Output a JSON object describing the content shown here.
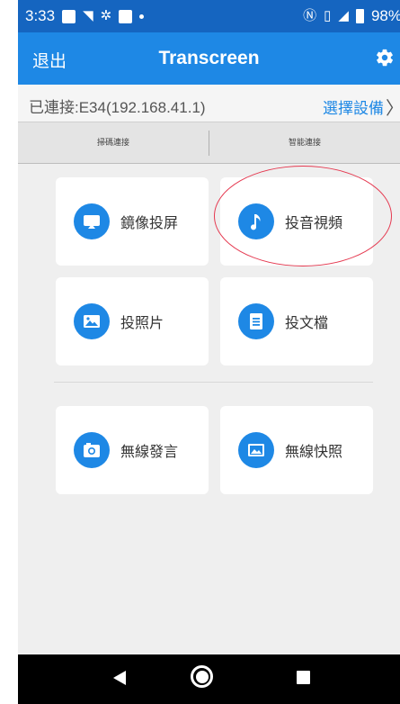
{
  "status_bar": {
    "time": "3:33",
    "battery": "98%"
  },
  "app_bar": {
    "exit_label": "退出",
    "title": "Transcreen"
  },
  "connection": {
    "status_text": "已連接:E34(192.168.41.1)",
    "select_device_label": "選擇設備",
    "chevron": "〉"
  },
  "tabs": [
    {
      "label": "掃碼連接"
    },
    {
      "label": "智能連接"
    }
  ],
  "features": [
    {
      "label": "鏡像投屏",
      "icon": "screen-mirror-icon"
    },
    {
      "label": "投音視頻",
      "icon": "music-note-icon"
    },
    {
      "label": "投照片",
      "icon": "photo-icon"
    },
    {
      "label": "投文檔",
      "icon": "document-icon"
    },
    {
      "label": "無線發言",
      "icon": "camera-icon"
    },
    {
      "label": "無線快照",
      "icon": "snapshot-icon"
    }
  ],
  "colors": {
    "status_bar": "#1565c0",
    "app_bar": "#1e88e5",
    "accent": "#1e88e5",
    "highlight_circle": "#e53950",
    "background": "#efefef"
  }
}
